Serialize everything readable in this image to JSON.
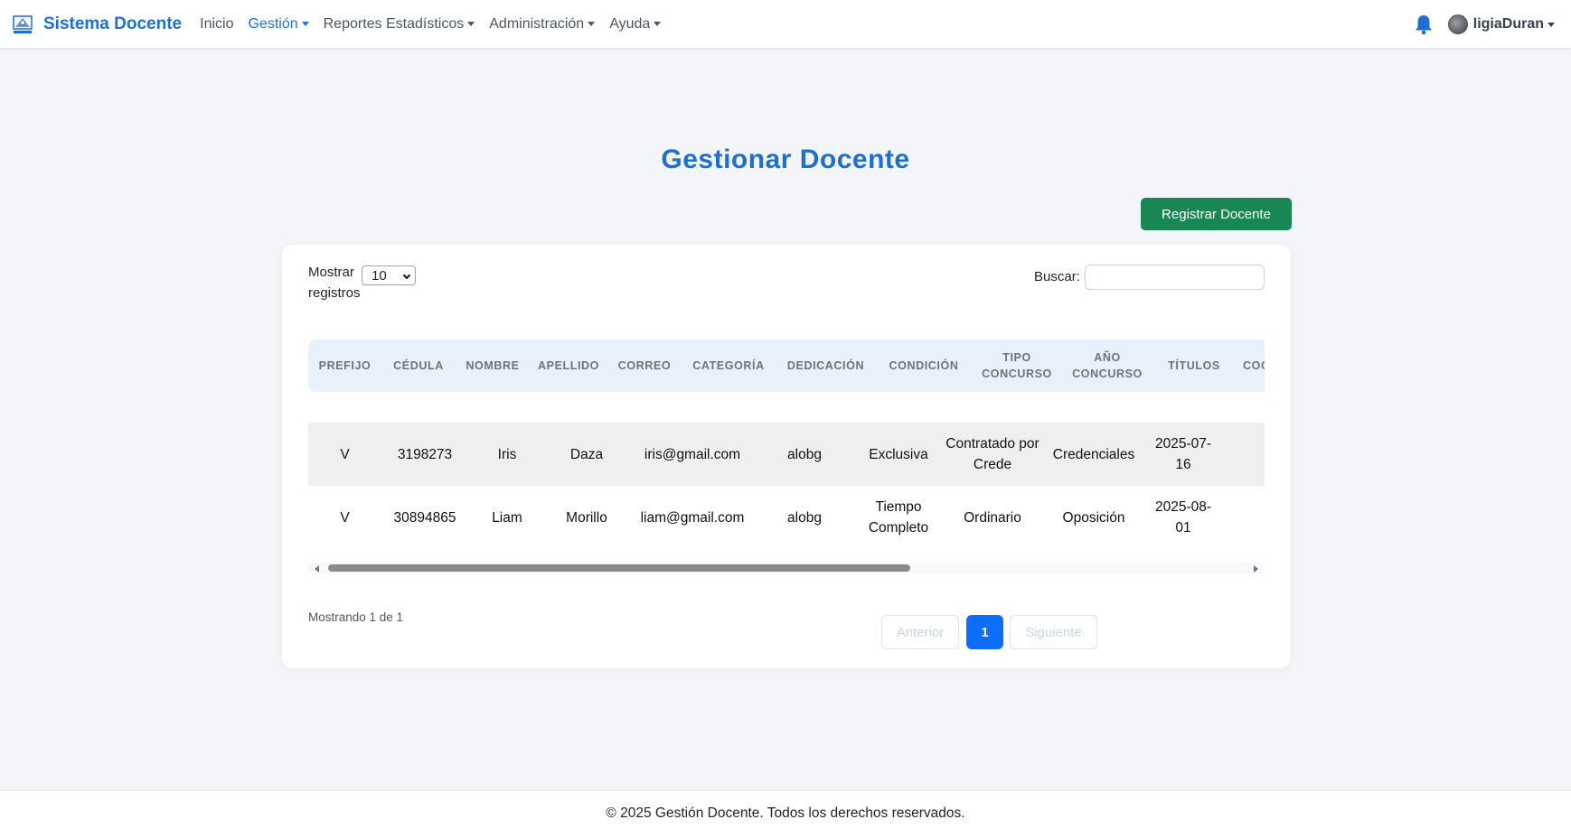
{
  "navbar": {
    "brand": "Sistema Docente",
    "links": [
      {
        "label": "Inicio"
      },
      {
        "label": "Gestión"
      },
      {
        "label": "Reportes Estadísticos"
      },
      {
        "label": "Administración"
      },
      {
        "label": "Ayuda"
      }
    ],
    "user": "ligiaDuran"
  },
  "page": {
    "title": "Gestionar Docente",
    "register_button": "Registrar Docente"
  },
  "table_controls": {
    "show_label": "Mostrar",
    "records_label": "registros",
    "page_length": "10",
    "search_label": "Buscar:"
  },
  "table": {
    "headers": [
      [
        "PREFIJO"
      ],
      [
        "CÉDULA"
      ],
      [
        "NOMBRE"
      ],
      [
        "APELLIDO"
      ],
      [
        "CORREO"
      ],
      [
        "CATEGORÍA"
      ],
      [
        "DEDICACIÓN"
      ],
      [
        "CONDICIÓN"
      ],
      [
        "TIPO",
        "CONCURSO"
      ],
      [
        "AÑO",
        "CONCURSO"
      ],
      [
        "TÍTULOS"
      ],
      [
        "COO"
      ]
    ],
    "rows": [
      [
        "V",
        "3198273",
        "Iris",
        "Daza",
        "iris@gmail.com",
        "alobg",
        "Exclusiva",
        "Contratado por Crede",
        "Credenciales",
        "2025-07-16"
      ],
      [
        "V",
        "30894865",
        "Liam",
        "Morillo",
        "liam@gmail.com",
        "alobg",
        "Tiempo Completo",
        "Ordinario",
        "Oposición",
        "2025-08-01"
      ]
    ]
  },
  "pagination": {
    "info": "Mostrando 1 de 1",
    "previous": "Anterior",
    "current": "1",
    "next": "Siguiente"
  },
  "footer": {
    "text": "© 2025 Gestión Docente. Todos los derechos reservados."
  },
  "colors": {
    "brand": "#1f6fd1",
    "success": "#198754",
    "primary": "#0d6efd"
  }
}
